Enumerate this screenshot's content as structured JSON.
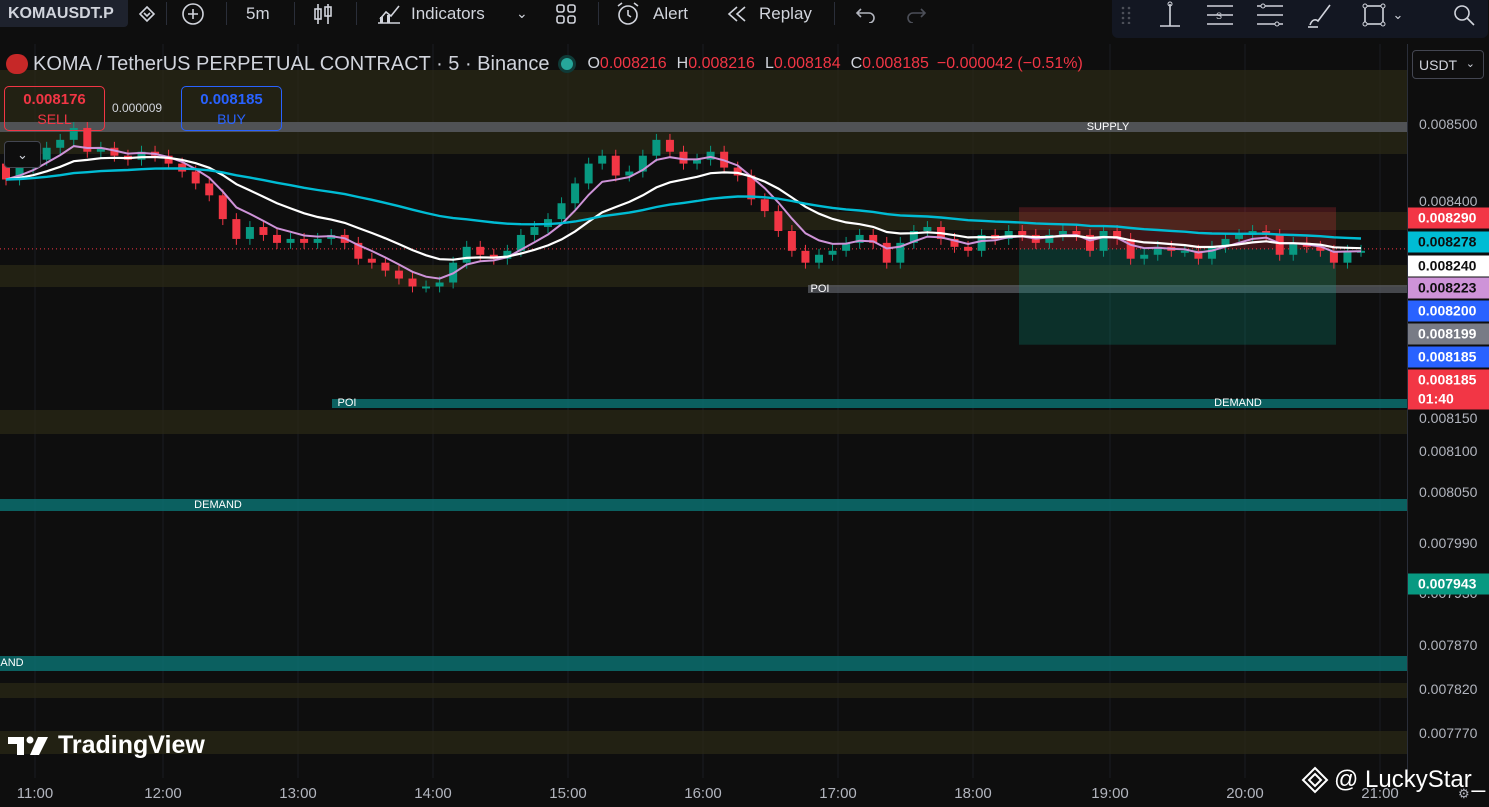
{
  "toolbar": {
    "symbol": "KOMAUSDT.P",
    "timeframe": "5m",
    "indicators_label": "Indicators",
    "alert_label": "Alert",
    "replay_label": "Replay"
  },
  "legend": {
    "title": "KOMA / TetherUS PERPETUAL CONTRACT · 5 · Binance",
    "open_prefix": "O",
    "open": "0.008216",
    "high_prefix": "H",
    "high": "0.008216",
    "low_prefix": "L",
    "low": "0.008184",
    "close_prefix": "C",
    "close": "0.008185",
    "change": "−0.000042 (−0.51%)"
  },
  "trade": {
    "sell_price": "0.008176",
    "sell_label": "SELL",
    "spread": "0.000009",
    "buy_price": "0.008185",
    "buy_label": "BUY"
  },
  "currency": "USDT",
  "price_ticks": [
    "0.008500",
    "0.008400",
    "0.008150",
    "0.008100",
    "0.008050",
    "0.007990",
    "0.007930",
    "0.007870",
    "0.007820",
    "0.007770"
  ],
  "price_labels": [
    {
      "text": "0.008290",
      "bg": "#f23645",
      "fg": "#ffffff"
    },
    {
      "text": "0.008278",
      "bg": "#00bcd4",
      "fg": "#0e0e0e"
    },
    {
      "text": "0.008240",
      "bg": "#ffffff",
      "fg": "#0e0e0e"
    },
    {
      "text": "0.008223",
      "bg": "#ce93d8",
      "fg": "#0e0e0e"
    },
    {
      "text": "0.008200",
      "bg": "#2962ff",
      "fg": "#ffffff"
    },
    {
      "text": "0.008199",
      "bg": "#787b86",
      "fg": "#ffffff"
    },
    {
      "text": "0.008185",
      "bg": "#2962ff",
      "fg": "#ffffff"
    },
    {
      "text": "0.008185",
      "bg": "#f23645",
      "fg": "#ffffff"
    },
    {
      "text": "01:40",
      "bg": "#f23645",
      "fg": "#ffffff"
    },
    {
      "text": "0.007943",
      "bg": "#089981",
      "fg": "#ffffff"
    }
  ],
  "time_ticks": [
    "11:00",
    "12:00",
    "13:00",
    "14:00",
    "15:00",
    "16:00",
    "17:00",
    "18:00",
    "19:00",
    "20:00",
    "21:00"
  ],
  "zone_labels": {
    "supply": "SUPPLY",
    "poi_left": "POI",
    "poi_right": "POI",
    "demand_right": "DEMAND",
    "demand_mid": "DEMAND",
    "demand_low": "AND"
  },
  "watermark": "TradingView",
  "credit": "@ LuckyStar_",
  "colors": {
    "up": "#089981",
    "down": "#f23645",
    "ema_fast": "#ce93d8",
    "ema_mid": "#ffffff",
    "ema_slow": "#00bcd4",
    "supply_zone": "#2b2a1c",
    "demand_zone": "#0b6e6e"
  },
  "chart_data": {
    "type": "candlestick",
    "symbol": "KOMAUSDT.P",
    "interval": "5",
    "x_range": [
      "10:55",
      "18:20"
    ],
    "ylim": [
      0.00774,
      0.00853
    ],
    "close_series": [
      0.00836,
      0.00839,
      0.00841,
      0.00844,
      0.00846,
      0.00849,
      0.00843,
      0.00844,
      0.00842,
      0.00841,
      0.00843,
      0.00842,
      0.0084,
      0.00838,
      0.00835,
      0.00832,
      0.00826,
      0.00821,
      0.00824,
      0.00822,
      0.0082,
      0.00821,
      0.0082,
      0.00821,
      0.00822,
      0.0082,
      0.00816,
      0.00815,
      0.00813,
      0.00811,
      0.00809,
      0.00809,
      0.0081,
      0.00815,
      0.00819,
      0.00817,
      0.00816,
      0.00818,
      0.00822,
      0.00824,
      0.00826,
      0.0083,
      0.00835,
      0.0084,
      0.00842,
      0.00837,
      0.00838,
      0.00842,
      0.00846,
      0.00843,
      0.0084,
      0.00841,
      0.00843,
      0.00839,
      0.00837,
      0.00831,
      0.00828,
      0.00823,
      0.00818,
      0.00815,
      0.00817,
      0.00818,
      0.0082,
      0.00822,
      0.0082,
      0.00815,
      0.0082,
      0.00823,
      0.00824,
      0.00821,
      0.00819,
      0.00818,
      0.00822,
      0.00821,
      0.00823,
      0.00822,
      0.0082,
      0.00822,
      0.00823,
      0.00822,
      0.00818,
      0.00823,
      0.00821,
      0.00816,
      0.00817,
      0.00819,
      0.00818,
      0.00818,
      0.00816,
      0.00819,
      0.00821,
      0.00822,
      0.00823,
      0.00822,
      0.00817,
      0.0082,
      0.00819,
      0.00818,
      0.00815,
      0.00818,
      0.00818
    ],
    "ema_labels": [
      "0.008223",
      "0.008240",
      "0.008278"
    ],
    "zones": [
      {
        "label": "SUPPLY",
        "price": 0.0085
      },
      {
        "label": "POI",
        "price": 0.00823
      },
      {
        "label": "POI",
        "price": 0.00815
      },
      {
        "label": "DEMAND",
        "price": 0.00815
      },
      {
        "label": "DEMAND",
        "price": 0.00805
      },
      {
        "label": "AND",
        "price": 0.00786
      }
    ],
    "position": {
      "entry": 0.008185,
      "stop": 0.00829,
      "target": 0.007943
    }
  }
}
